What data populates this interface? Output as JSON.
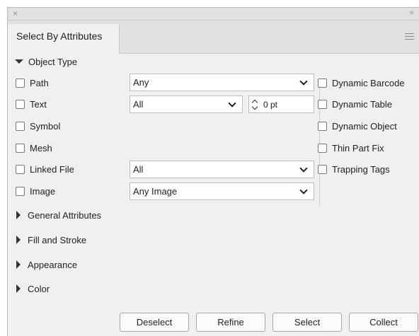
{
  "titlebar": {
    "close_glyph": "×",
    "collapse_glyph": "‹‹"
  },
  "tab": {
    "label": "Select By Attributes"
  },
  "object_type": {
    "label": "Object Type",
    "left_items": [
      {
        "label": "Path"
      },
      {
        "label": "Text"
      },
      {
        "label": "Symbol"
      },
      {
        "label": "Mesh"
      },
      {
        "label": "Linked File"
      },
      {
        "label": "Image"
      }
    ],
    "right_items": [
      {
        "label": "Dynamic Barcode"
      },
      {
        "label": "Dynamic Table"
      },
      {
        "label": "Dynamic Object"
      },
      {
        "label": "Thin Part Fix"
      },
      {
        "label": "Trapping Tags"
      }
    ],
    "path_dropdown": "Any",
    "text_dropdown": "All",
    "text_size": "0 pt",
    "linked_file_dropdown": "All",
    "image_dropdown": "Any Image"
  },
  "sections": [
    {
      "label": "General Attributes"
    },
    {
      "label": "Fill and Stroke"
    },
    {
      "label": "Appearance"
    },
    {
      "label": "Color"
    }
  ],
  "buttons": {
    "deselect": "Deselect",
    "refine": "Refine",
    "select": "Select",
    "collect": "Collect"
  }
}
